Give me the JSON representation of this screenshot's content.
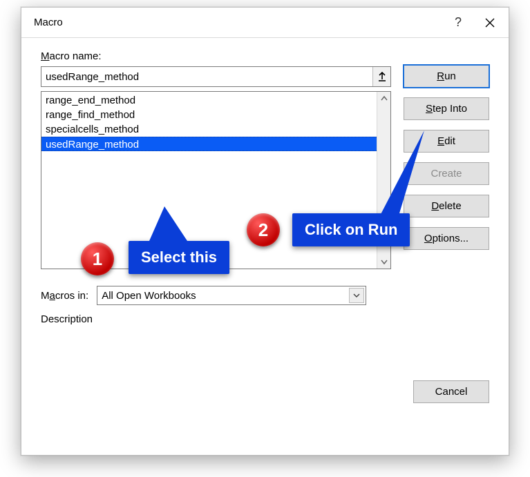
{
  "dialog": {
    "title": "Macro",
    "help": "?",
    "close": "✕"
  },
  "labels": {
    "macro_name": "Macro name:",
    "macros_in": "Macros in:",
    "description": "Description"
  },
  "macro_name_value": "usedRange_method",
  "list_items": [
    "range_end_method",
    "range_find_method",
    "specialcells_method",
    "usedRange_method"
  ],
  "selected_index": 3,
  "macros_in_value": "All Open Workbooks",
  "buttons": {
    "run": "Run",
    "step_into": "Step Into",
    "edit": "Edit",
    "create": "Create",
    "delete": "Delete",
    "options": "Options...",
    "cancel": "Cancel"
  },
  "callouts": {
    "select": "Select this",
    "run": "Click on Run",
    "badge1": "1",
    "badge2": "2"
  }
}
